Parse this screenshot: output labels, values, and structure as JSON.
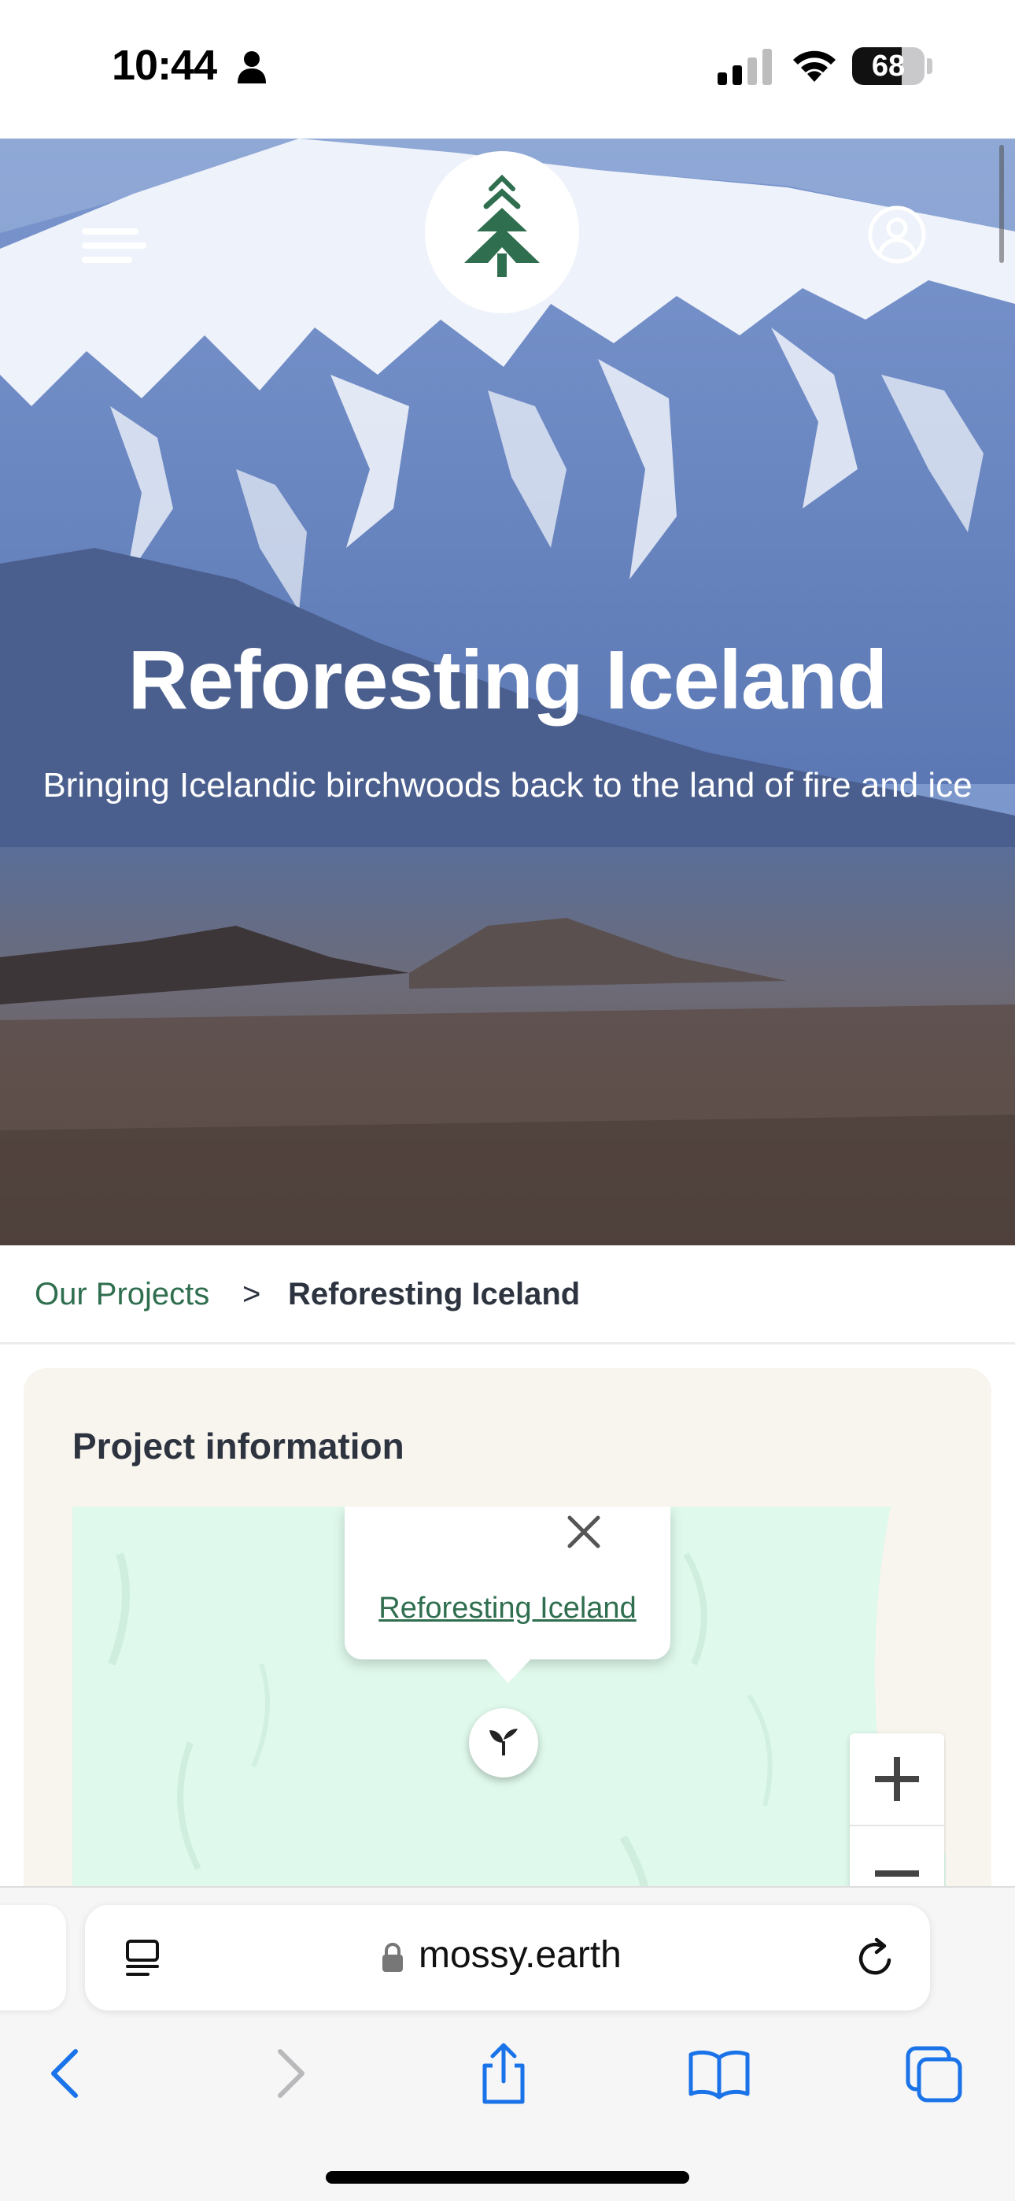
{
  "status_bar": {
    "time": "10:44",
    "battery": "68",
    "battery_level": 0.68,
    "icons": [
      "person-icon",
      "cellular-signal-icon",
      "wifi-icon",
      "battery-icon"
    ]
  },
  "hero": {
    "title": "Reforesting Iceland",
    "subtitle": "Bringing Icelandic birchwoods back to the land of fire and ice",
    "icons": [
      "hamburger-menu-icon",
      "mossy-earth-logo",
      "account-icon"
    ]
  },
  "breadcrumb": {
    "parent": "Our Projects",
    "separator": ">",
    "current": "Reforesting Iceland"
  },
  "project_info": {
    "title": "Project information",
    "map": {
      "popup_link": "Reforesting Iceland",
      "icons": [
        "close-icon",
        "sprout-icon",
        "zoom-in-icon",
        "zoom-out-icon"
      ]
    }
  },
  "browser": {
    "url": "mossy.earth",
    "icons": [
      "reader-icon",
      "lock-icon",
      "reload-icon",
      "back-icon",
      "forward-icon",
      "share-icon",
      "bookmarks-icon",
      "tabs-icon"
    ]
  },
  "colors": {
    "brand_green": "#2f6e4f",
    "card_background": "#f8f4ee",
    "map_background": "#dff9ec"
  }
}
